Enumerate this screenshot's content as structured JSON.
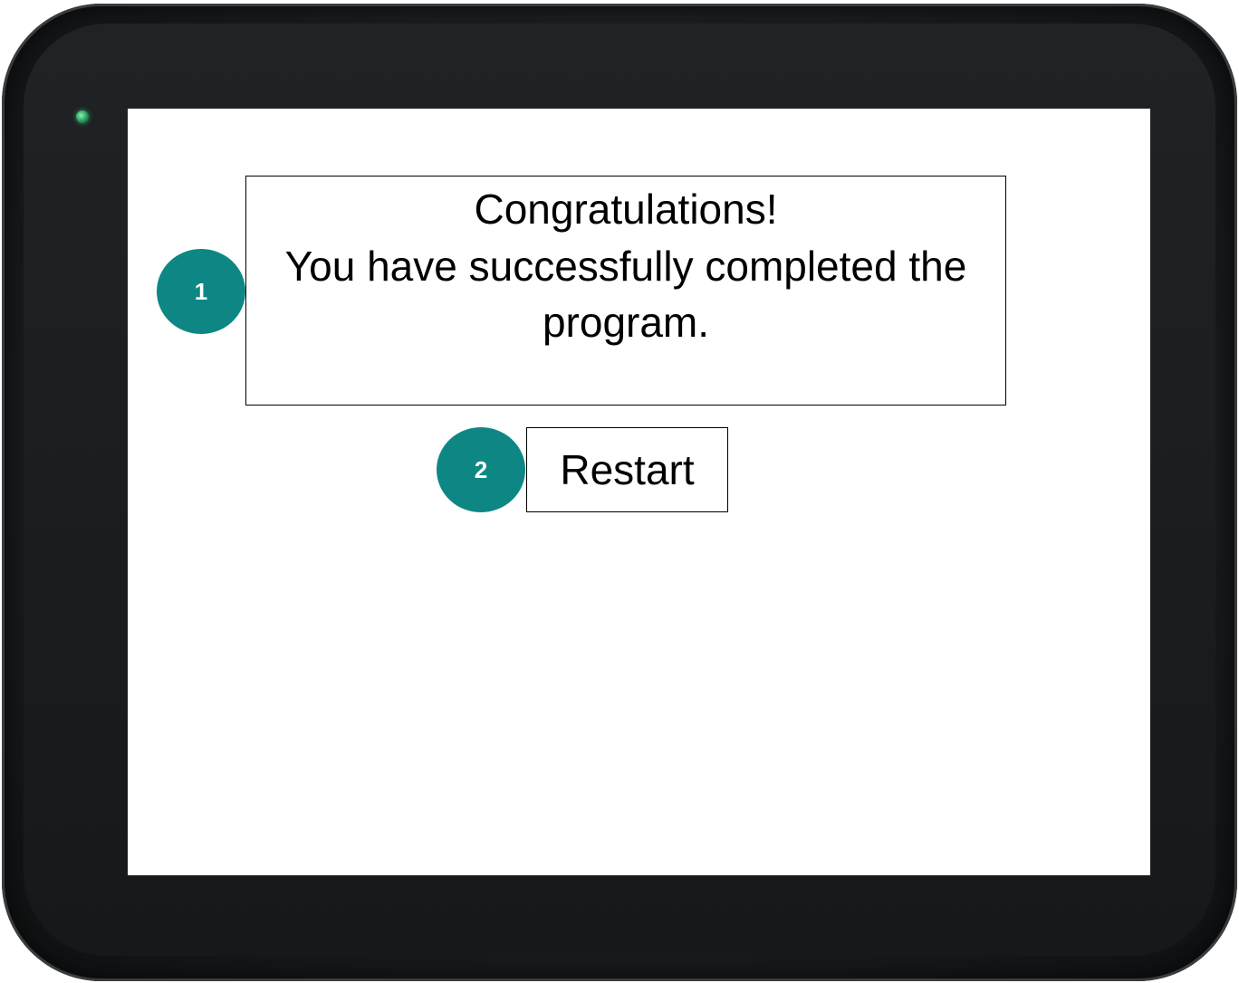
{
  "message": {
    "title": "Congratulations!",
    "body": "You have successfully completed the program."
  },
  "restart_button": {
    "label": "Restart"
  },
  "callouts": [
    {
      "label": "1"
    },
    {
      "label": "2"
    }
  ],
  "colors": {
    "callout": "#0e8784",
    "led": "#1f9a5a",
    "bezel": "#1c1e20",
    "screen": "#ffffff"
  }
}
